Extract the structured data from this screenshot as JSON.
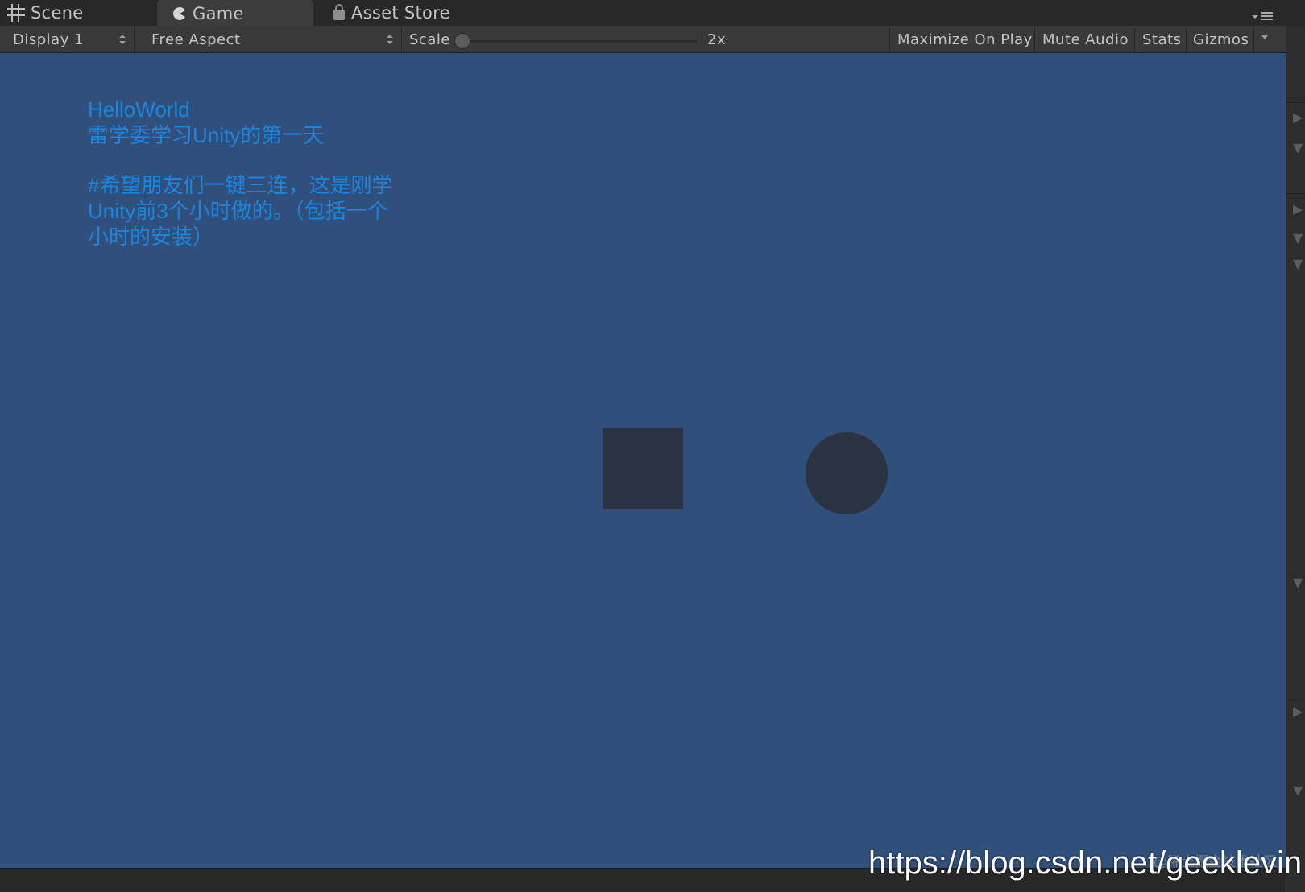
{
  "tabs": [
    {
      "label": "Scene",
      "icon": "grid-icon"
    },
    {
      "label": "Game",
      "icon": "pacman-icon",
      "active": true
    },
    {
      "label": "Asset Store",
      "icon": "bag-icon"
    }
  ],
  "toolbar": {
    "display": "Display 1",
    "aspect": "Free Aspect",
    "scale_label": "Scale",
    "scale_value": "2x",
    "maximize_on_play": "Maximize On Play",
    "mute_audio": "Mute Audio",
    "stats": "Stats",
    "gizmos": "Gizmos"
  },
  "game_view": {
    "background_color": "#304f7a",
    "text_lines": {
      "line1": "HelloWorld",
      "line2": "雷学委学习Unity的第一天",
      "line3": "#希望朋友们一键三连，这是刚学",
      "line4": "Unity前3个小时做的。（包括一个",
      "line5": "小时的安装）"
    },
    "text_color": "#1a86e0",
    "shape_color": "#2a3342"
  },
  "watermarks": {
    "small": "@稀土掘金技术社区",
    "url": "https://blog.csdn.net/geeklevin"
  }
}
